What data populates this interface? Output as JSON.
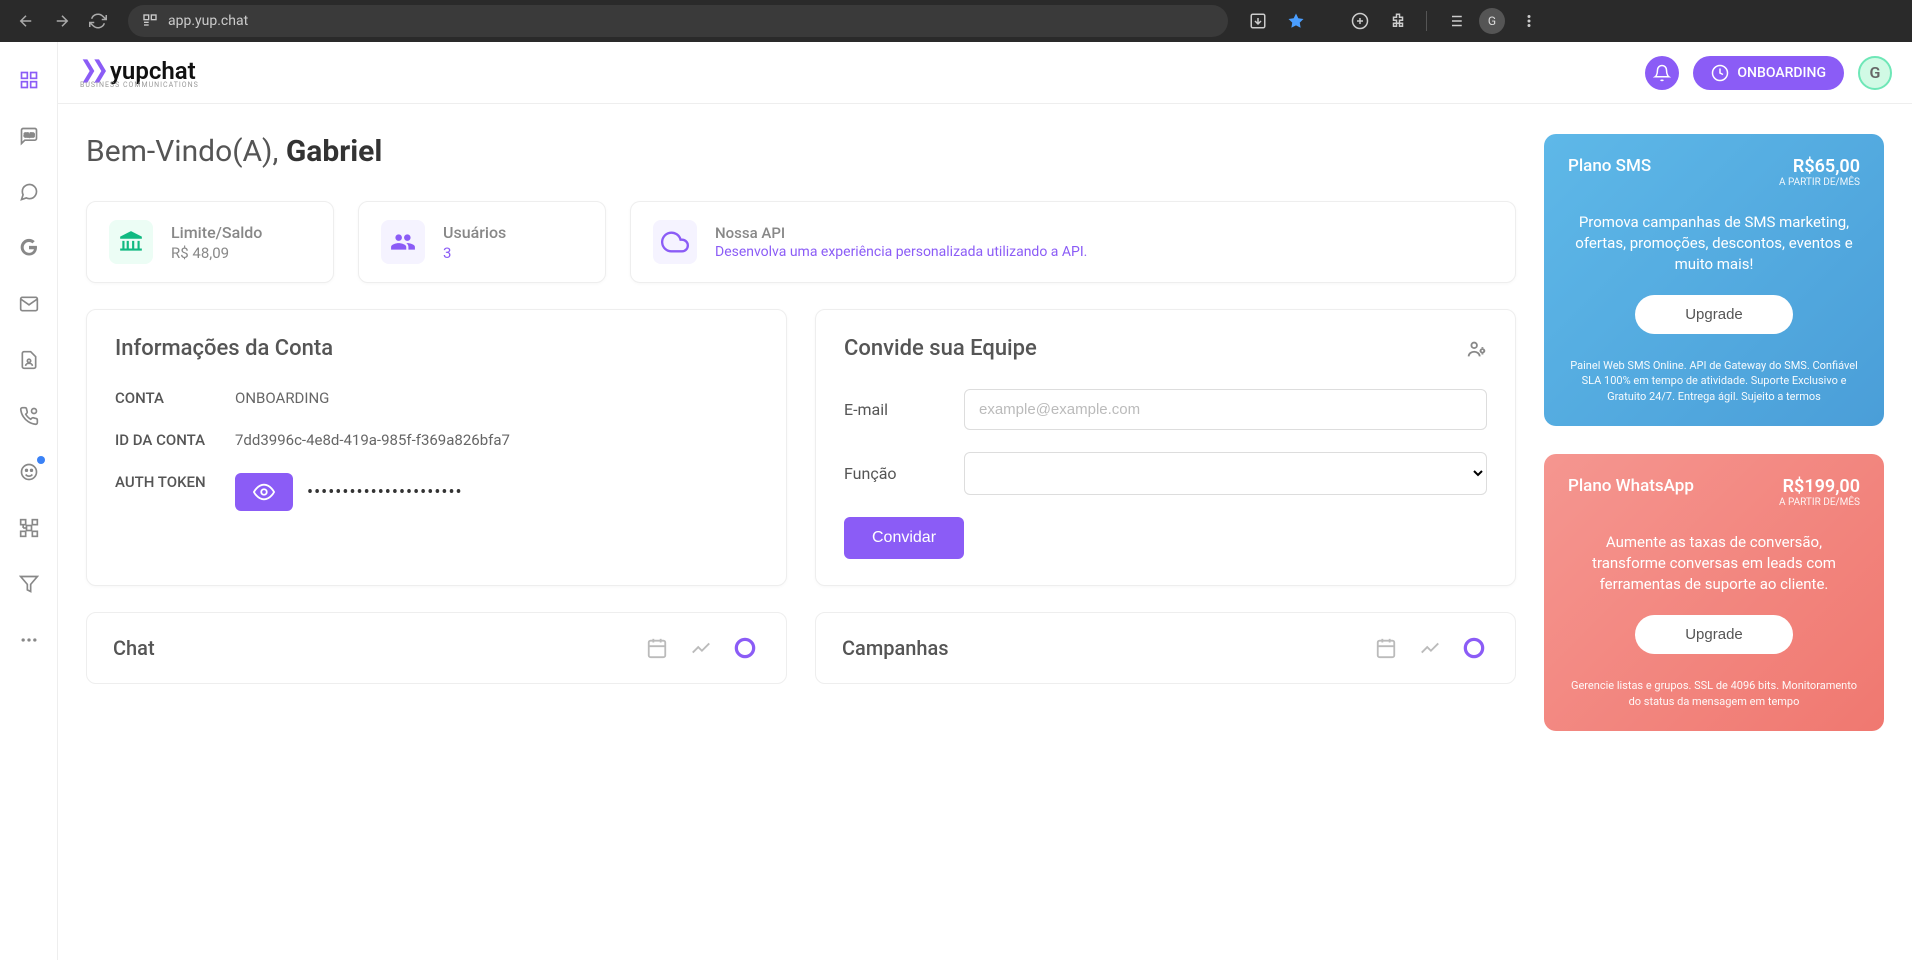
{
  "browser": {
    "url": "app.yup.chat",
    "avatar": "G"
  },
  "topbar": {
    "brand": "yupchat",
    "brand_sub": "BUSINESS COMMUNICATIONS",
    "onboarding_label": "ONBOARDING",
    "user_initial": "G"
  },
  "welcome": {
    "greeting": "Bem-Vindo(A), ",
    "name": "Gabriel"
  },
  "stats": {
    "balance": {
      "label": "Limite/Saldo",
      "value": "R$ 48,09"
    },
    "users": {
      "label": "Usuários",
      "value": "3"
    },
    "api": {
      "title": "Nossa API",
      "desc": "Desenvolva uma experiência personalizada utilizando a API."
    }
  },
  "account_info": {
    "title": "Informações da Conta",
    "rows": {
      "account_label": "CONTA",
      "account_value": "ONBOARDING",
      "id_label": "ID DA CONTA",
      "id_value": "7dd3996c-4e8d-419a-985f-f369a826bfa7",
      "token_label": "AUTH TOKEN",
      "token_masked": "••••••••••••••••••••••"
    }
  },
  "invite": {
    "title": "Convide sua Equipe",
    "email_label": "E-mail",
    "email_placeholder": "example@example.com",
    "role_label": "Função",
    "button": "Convidar"
  },
  "chat_panel": {
    "title": "Chat"
  },
  "campaigns_panel": {
    "title": "Campanhas"
  },
  "promo_sms": {
    "name": "Plano SMS",
    "price": "R$65,00",
    "price_sub": "A PARTIR DE/MÊS",
    "desc": "Promova campanhas de SMS marketing, ofertas, promoções, descontos, eventos e muito mais!",
    "button": "Upgrade",
    "fine": "Painel Web SMS Online. API de Gateway do SMS. Confiável SLA 100% em tempo de atividade. Suporte Exclusivo e Gratuito 24/7. Entrega ágil. Sujeito a termos"
  },
  "promo_wa": {
    "name": "Plano WhatsApp",
    "price": "R$199,00",
    "price_sub": "A PARTIR DE/MÊS",
    "desc": "Aumente as taxas de conversão, transforme conversas em leads com ferramentas de suporte ao cliente.",
    "button": "Upgrade",
    "fine": "Gerencie listas e grupos. SSL de 4096 bits. Monitoramento do status da mensagem em tempo"
  }
}
